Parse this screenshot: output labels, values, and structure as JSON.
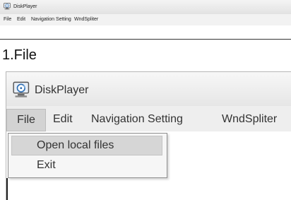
{
  "small_window": {
    "title": "DiskPlayer",
    "menu": [
      "File",
      "Edit",
      "Navigation Setting",
      "WndSpliter"
    ]
  },
  "section_heading": "1.File",
  "large_window": {
    "title": "DiskPlayer",
    "menu": [
      "File",
      "Edit",
      "Navigation Setting",
      "WndSpliter"
    ],
    "active_menu": "File",
    "file_dropdown": {
      "items": [
        "Open local files",
        "Exit"
      ],
      "highlighted": "Open local files"
    }
  },
  "icons": {
    "app_icon": "disk-monitor-icon"
  },
  "colors": {
    "menubar_bg": "#eeeeee",
    "highlight_bg": "#d6d6d6",
    "icon_blue": "#2f6fb3"
  }
}
